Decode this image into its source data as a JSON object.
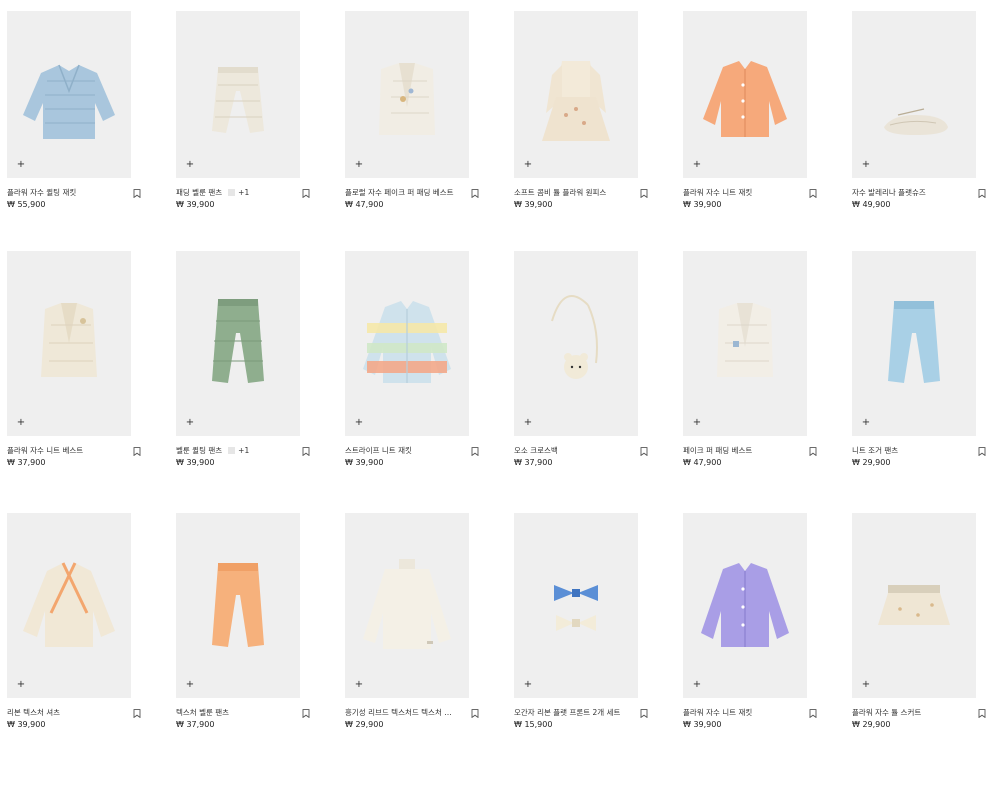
{
  "ui": {
    "add_icon": "+",
    "bookmark_icon": "bookmark-icon"
  },
  "products": [
    {
      "name": "플라워 자수 퀼팅 재킷",
      "price": "₩ 55,900",
      "illustration": "quilted-jacket",
      "color": "#a9c6dd"
    },
    {
      "name": "패딩 벨룬 팬츠",
      "price": "₩ 39,900",
      "more": "+1",
      "illustration": "quilted-pants",
      "color": "#ede8dc"
    },
    {
      "name": "플로럴 자수 페이크 퍼 패딩 베스트",
      "price": "₩ 47,900",
      "illustration": "fur-vest",
      "color": "#f1ede4"
    },
    {
      "name": "소프트 콤비 튤 플라워 원피스",
      "price": "₩ 39,900",
      "illustration": "tulle-dress",
      "color": "#efe3cf"
    },
    {
      "name": "플라워 자수 니트 재킷",
      "price": "₩ 39,900",
      "illustration": "orange-cardigan",
      "color": "#f6a97b"
    },
    {
      "name": "자수 발레리나 플랫슈즈",
      "price": "₩ 49,900",
      "illustration": "ballet-flat",
      "color": "#eae4d8"
    },
    {
      "name": "플라워 자수 니트 베스트",
      "price": "₩ 37,900",
      "illustration": "knit-vest",
      "color": "#efe8d8"
    },
    {
      "name": "벨룬 퀼팅 팬츠",
      "price": "₩ 39,900",
      "more": "+1",
      "illustration": "green-pants",
      "color": "#8fae8e"
    },
    {
      "name": "스트라이프 니트 재킷",
      "price": "₩ 39,900",
      "illustration": "stripe-cardigan",
      "color": "#cfe2ec"
    },
    {
      "name": "오소 크로스백",
      "price": "₩ 37,900",
      "illustration": "bear-bag",
      "color": "#f1ead8"
    },
    {
      "name": "페이크 퍼 패딩 베스트",
      "price": "₩ 47,900",
      "illustration": "fur-vest-plain",
      "color": "#f2eee6"
    },
    {
      "name": "니트 조거 팬츠",
      "price": "₩ 29,900",
      "illustration": "blue-joggers",
      "color": "#a9d0e6"
    },
    {
      "name": "리본 텍스처 셔츠",
      "price": "₩ 39,900",
      "illustration": "wrap-shirt",
      "color": "#f1e8d6"
    },
    {
      "name": "텍스처 벨룬 팬츠",
      "price": "₩ 37,900",
      "illustration": "orange-pants",
      "color": "#f6b17c"
    },
    {
      "name": "흥기성 리브드 텍스처드 텍스처 티셔츠",
      "price": "₩ 29,900",
      "illustration": "turtleneck",
      "color": "#f4f0e6"
    },
    {
      "name": "오간자 리본 플랫 프론트 2개 세트",
      "price": "₩ 15,900",
      "illustration": "hair-bows",
      "color": "#5b8fd6"
    },
    {
      "name": "플라워 자수 니트 재킷",
      "price": "₩ 39,900",
      "illustration": "lilac-cardigan",
      "color": "#a99ee6"
    },
    {
      "name": "플라워 자수 튤 스커트",
      "price": "₩ 29,900",
      "illustration": "tulle-skirt",
      "color": "#efe6d4"
    }
  ]
}
